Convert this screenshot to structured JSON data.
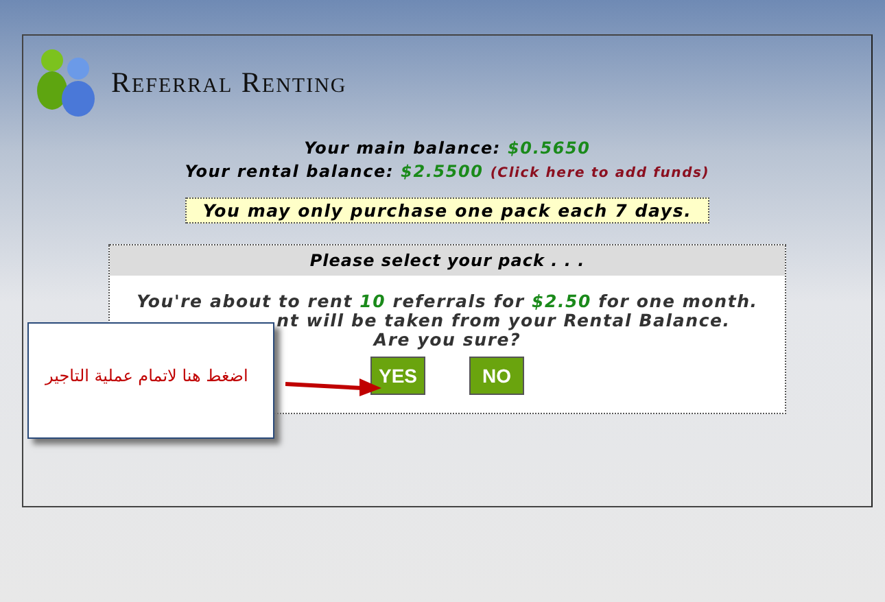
{
  "header": {
    "title": "Referral Renting"
  },
  "balances": [
    {
      "label": "Your main balance:",
      "amount": "$0.5650"
    },
    {
      "label": "Your rental balance:",
      "amount": "$2.5500",
      "link": "(Click here to add funds)"
    }
  ],
  "notice": "You may only purchase one pack each 7 days.",
  "pack": {
    "heading": "Please select your pack . . .",
    "lines": [
      "You're about to rent **10** referrals for **$2.50** for one month.",
      "nt will be taken from your Rental Balance.",
      "Are you sure?"
    ],
    "buttons": [
      "YES",
      "NO"
    ]
  },
  "callout": {
    "text": "اضغط هنا لاتمام عملية التاجير"
  }
}
